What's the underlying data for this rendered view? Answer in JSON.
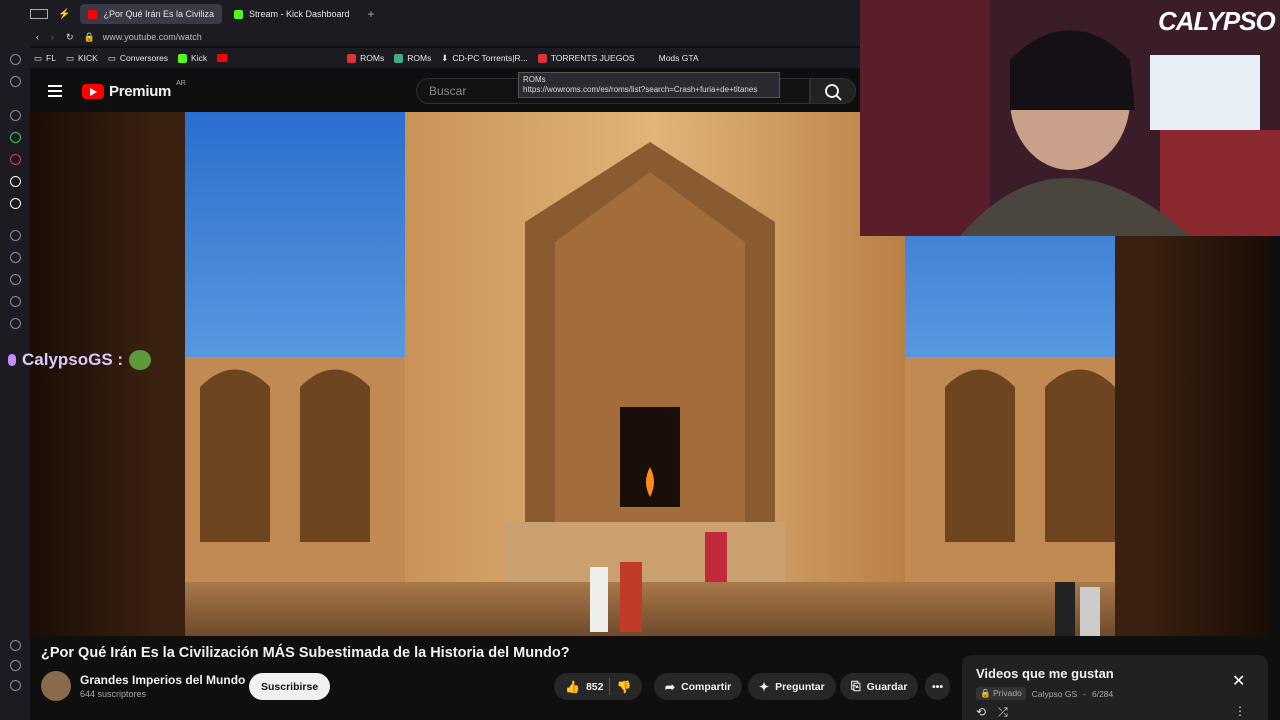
{
  "browser": {
    "tabs": [
      {
        "label": "¿Por Qué Irán Es la Civiliza",
        "active": true,
        "color": "#ff0000"
      },
      {
        "label": "Stream - Kick Dashboard",
        "active": false,
        "color": "#53fc18"
      }
    ],
    "url": "www.youtube.com/watch",
    "bookmarks": [
      {
        "label": "FL",
        "color": "#888888"
      },
      {
        "label": "KICK",
        "color": "#888888"
      },
      {
        "label": "Conversores",
        "color": "#888888"
      },
      {
        "label": "Kick",
        "color": "#53fc18"
      },
      {
        "label": "ROMs",
        "color": "#d33"
      },
      {
        "label": "ROMs",
        "color": "#4a8"
      },
      {
        "label": "CD-PC Torrents|R...",
        "color": "#fff"
      },
      {
        "label": "TORRENTS JUEGOS",
        "color": "#d33"
      },
      {
        "label": "Mods GTA",
        "color": "#888"
      }
    ],
    "tooltip": {
      "title": "ROMs",
      "url": "https://wowroms.com/es/roms/list?search=Crash+furia+de+titanes"
    }
  },
  "youtube": {
    "logo_text": "Premium",
    "country_code": "AR",
    "search_placeholder": "Buscar"
  },
  "overlay": {
    "username": "CalypsoGS :",
    "cam_logo": "CALYPSO"
  },
  "video": {
    "title": "¿Por Qué Irán Es la Civilización MÁS Subestimada de la Historia del Mundo?",
    "channel": "Grandes Imperios del Mundo",
    "subscribers": "644 suscriptores",
    "subscribe_label": "Suscribirse",
    "likes": "852",
    "share_label": "Compartir",
    "ask_label": "Preguntar",
    "save_label": "Guardar"
  },
  "playlist": {
    "title": "Videos que me gustan",
    "privacy": "Privado",
    "owner": "Calypso GS",
    "position": "6/284"
  }
}
